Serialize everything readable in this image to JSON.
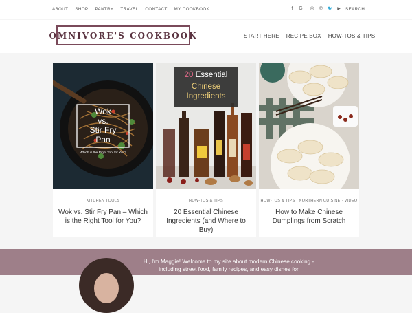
{
  "topnav": {
    "items": [
      "ABOUT",
      "SHOP",
      "PANTRY",
      "TRAVEL",
      "CONTACT",
      "MY COOKBOOK"
    ],
    "social_icons": [
      {
        "name": "facebook-icon",
        "glyph": "f"
      },
      {
        "name": "google-plus-icon",
        "glyph": "G+"
      },
      {
        "name": "instagram-icon",
        "glyph": "◎"
      },
      {
        "name": "pinterest-icon",
        "glyph": "℗"
      },
      {
        "name": "twitter-icon",
        "glyph": "🐦"
      },
      {
        "name": "youtube-icon",
        "glyph": "▶"
      }
    ],
    "search_label": "SEARCH"
  },
  "header": {
    "logo_text": "OMNIVORE'S COOKBOOK",
    "nav": [
      "START HERE",
      "RECIPE BOX",
      "HOW-TOS & TIPS"
    ]
  },
  "cards": [
    {
      "overlay": {
        "lines": [
          "Wok",
          "vs.",
          "Stir Fry",
          "Pan"
        ],
        "tagline": "Which is the Right Tool for You?"
      },
      "category": "KITCHEN TOOLS",
      "title": "Wok vs. Stir Fry Pan – Which is the Right Tool for You?"
    },
    {
      "overlay": {
        "number": "20",
        "word": "Essential",
        "line2": "Chinese",
        "line3": "Ingredients"
      },
      "category": "HOW-TOS & TIPS",
      "title": "20 Essential Chinese Ingredients (and Where to Buy)"
    },
    {
      "category": "HOW-TOS & TIPS · NORTHERN CUISINE · VIDEO",
      "title": "How to Make Chinese Dumplings from Scratch"
    }
  ],
  "footer": {
    "welcome": "Hi, I'm Maggie! Welcome to my site about modern Chinese cooking - including street food, family recipes, and easy dishes for"
  },
  "colors": {
    "brand": "#7a4a5a",
    "footer": "#9e7f89",
    "accent": "#f2d27a"
  }
}
